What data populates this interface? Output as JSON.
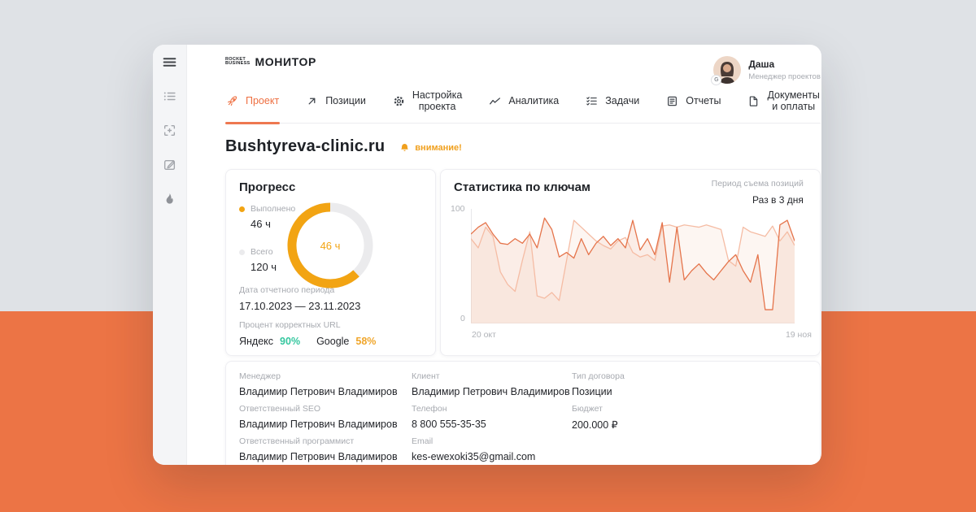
{
  "logo": {
    "mark_line1": "ROCKET",
    "mark_line2": "BUSINESS",
    "product": "МОНИТОР"
  },
  "user": {
    "name": "Даша",
    "role": "Менеджер проектов",
    "badge": "G"
  },
  "sidebar": {
    "icons": [
      "menu",
      "list",
      "focus",
      "edit",
      "fire"
    ]
  },
  "nav": {
    "tabs": [
      {
        "label": "Проект",
        "icon": "rocket-icon",
        "active": true
      },
      {
        "label": "Позиции",
        "icon": "arrow-up-right-icon",
        "active": false
      },
      {
        "label": "Настройка проекта",
        "icon": "gear-icon",
        "active": false
      },
      {
        "label": "Аналитика",
        "icon": "chart-line-icon",
        "active": false
      },
      {
        "label": "Задачи",
        "icon": "checklist-icon",
        "active": false
      },
      {
        "label": "Отчеты",
        "icon": "report-icon",
        "active": false
      },
      {
        "label": "Документы и оплаты",
        "icon": "document-icon",
        "active": false
      }
    ]
  },
  "page": {
    "title": "Bushtyreva-clinic.ru",
    "alert": "внимание!"
  },
  "progress": {
    "title": "Прогресс",
    "legend": [
      {
        "label": "Выполнено",
        "value": "46 ч",
        "color": "#F2A413"
      },
      {
        "label": "Всего",
        "value": "120 ч",
        "color": "#EBEBED"
      }
    ],
    "done_hours": 46,
    "total_hours": 120,
    "center_label": "46 ч",
    "period_label": "Дата отчетного периода",
    "period_value": "17.10.2023 — 23.11.2023",
    "url_label": "Процент корректных URL",
    "url_stats": [
      {
        "engine": "Яндекс",
        "percent": "90%",
        "color": "#35C79F"
      },
      {
        "engine": "Google",
        "percent": "58%",
        "color": "#F0A62B"
      }
    ]
  },
  "stats": {
    "title": "Статистика по ключам",
    "period_label": "Период съема позиций",
    "period_value": "Раз в 3 дня",
    "y_max": "100",
    "y_min": "0",
    "x_start": "20 окт",
    "x_end": "19 ноя",
    "chart_data": {
      "type": "line",
      "ylim": [
        0,
        100
      ],
      "x_range": [
        "20 окт",
        "19 ноя"
      ],
      "grid": false,
      "legend": "none",
      "series": [
        {
          "name": "series-1",
          "color": "#E5744B",
          "fill": "rgba(243,196,175,0.30)",
          "values": [
            78,
            84,
            88,
            78,
            70,
            69,
            74,
            70,
            78,
            66,
            92,
            82,
            58,
            62,
            57,
            74,
            60,
            70,
            76,
            68,
            74,
            66,
            90,
            64,
            74,
            60,
            88,
            36,
            84,
            38,
            46,
            52,
            44,
            38,
            46,
            54,
            60,
            46,
            36,
            60,
            12,
            12,
            86,
            90,
            72
          ]
        },
        {
          "name": "series-2",
          "color": "#F5BCA4",
          "fill": "rgba(247,214,198,0.22)",
          "values": [
            74,
            66,
            84,
            76,
            45,
            34,
            28,
            55,
            80,
            24,
            22,
            27,
            20,
            55,
            90,
            84,
            78,
            72,
            68,
            65,
            72,
            75,
            62,
            58,
            60,
            55,
            85,
            86,
            84,
            86,
            85,
            84,
            86,
            84,
            82,
            55,
            50,
            84,
            80,
            78,
            76,
            85,
            72,
            80,
            68
          ]
        }
      ]
    }
  },
  "info": {
    "columns": [
      [
        {
          "label": "Менеджер",
          "value": "Владимир Петрович Владимиров"
        },
        {
          "label": "Ответственный SEO",
          "value": "Владимир Петрович Владимиров"
        },
        {
          "label": "Ответственный программист",
          "value": "Владимир Петрович Владимиров"
        }
      ],
      [
        {
          "label": "Клиент",
          "value": "Владимир Петрович Владимиров"
        },
        {
          "label": "Телефон",
          "value": "8 800 555-35-35"
        },
        {
          "label": "Email",
          "value": "kes-ewexoki35@gmail.com"
        }
      ],
      [
        {
          "label": "Тип договора",
          "value": "Позиции"
        },
        {
          "label": "Бюджет",
          "value": "200.000 ₽"
        }
      ]
    ]
  },
  "colors": {
    "page_bottom": "#EC7445",
    "page_top": "#DFE2E6",
    "accent": "#EE7850",
    "amber": "#F2A413",
    "green": "#35C79F",
    "line_dark": "#E5744B",
    "line_light": "#F5BCA4"
  }
}
